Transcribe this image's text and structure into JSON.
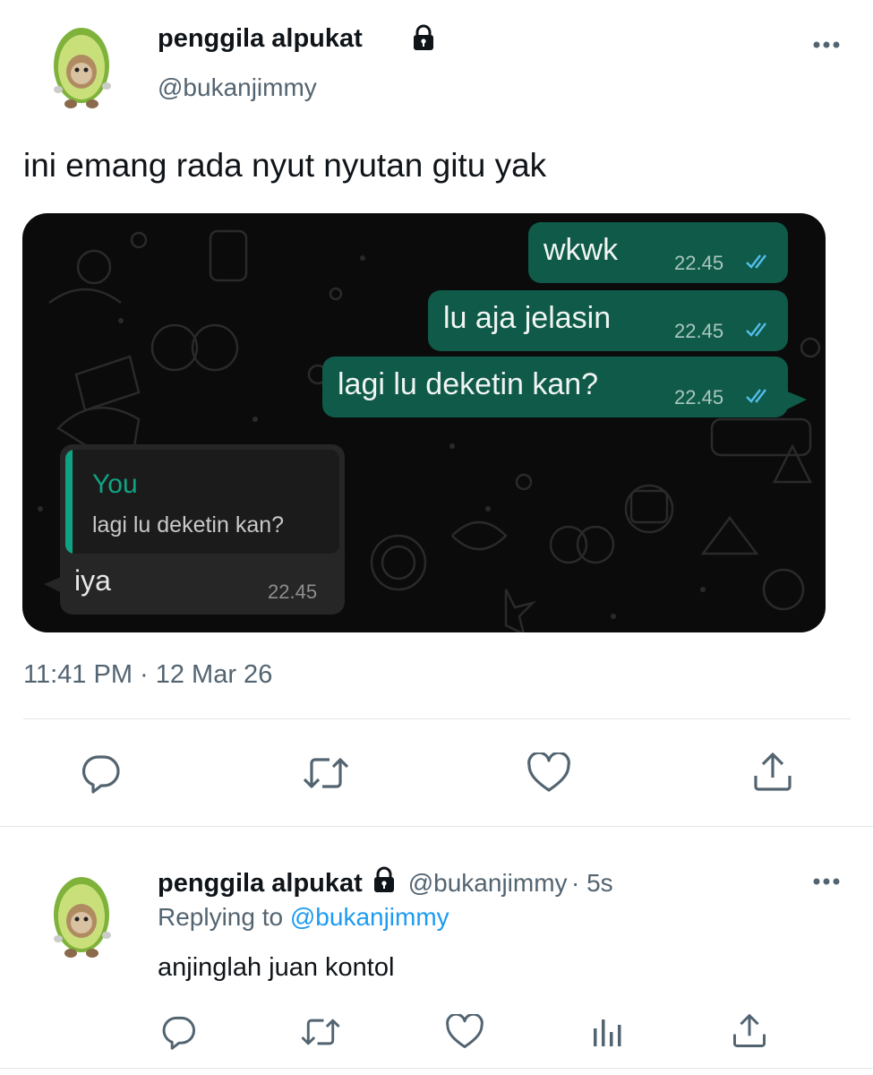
{
  "tweet": {
    "author_name": "penggila alpukat",
    "author_handle": "@bukanjimmy",
    "text": "ini emang rada nyut nyutan gitu yak",
    "timestamp": "11:41 PM · 12 Mar 26",
    "icons": [
      "avatar-avocado",
      "lock-icon",
      "more-icon"
    ]
  },
  "chat": {
    "sent": [
      {
        "text": "wkwk",
        "time": "22.45"
      },
      {
        "text": "lu aja jelasin",
        "time": "22.45"
      },
      {
        "text": "lagi lu deketin kan?",
        "time": "22.45"
      }
    ],
    "received": {
      "quote_author": "You",
      "quote_text": "lagi lu deketin kan?",
      "text": "iya",
      "time": "22.45"
    },
    "colors": {
      "sent_bubble": "#0f5a48",
      "received_bubble": "#262626",
      "accent": "#10a383",
      "read_ticks": "#53bdeb"
    }
  },
  "actions": [
    "reply-icon",
    "retweet-icon",
    "like-icon",
    "share-icon"
  ],
  "reply": {
    "author_name": "penggila alpukat",
    "author_handle": "@bukanjimmy",
    "time": "· 5s",
    "replying_prefix": "Replying to",
    "replying_handle": "@bukanjimmy",
    "text": "anjinglah juan kontol",
    "actions": [
      "reply-icon",
      "retweet-icon",
      "like-icon",
      "analytics-icon",
      "share-icon"
    ]
  },
  "colors": {
    "link": "#1d9bf0",
    "secondary_text": "#536471",
    "divider": "#e3e6e8"
  }
}
